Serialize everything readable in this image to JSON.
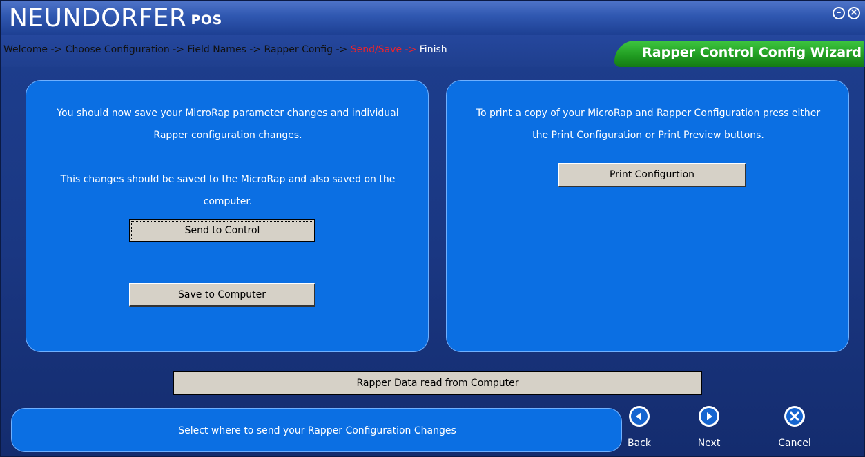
{
  "app": {
    "brand": "NEUNDORFER",
    "brand_suffix": "POS",
    "minimize_glyph": "–",
    "close_glyph": "×"
  },
  "breadcrumb": {
    "steps_before": "Welcome -> Choose Configuration -> Field Names -> Rapper Config -> ",
    "active": "Send/Save",
    "arrow": " -> ",
    "finish": "Finish"
  },
  "wizard_title": "Rapper Control Config Wizard",
  "left_panel": {
    "para1": "You should now save your MicroRap parameter changes and individual Rapper configuration changes.",
    "para2": "This changes should be saved to the MicroRap and also saved on the computer.",
    "send_button": "Send to Control",
    "save_button": "Save to Computer"
  },
  "right_panel": {
    "para1": "To print a copy of your MicroRap and Rapper Configuration press either the Print Configuration or Print Preview buttons.",
    "print_button": "Print Configurtion"
  },
  "status": "Rapper Data read from Computer",
  "hint": "Select where to send your Rapper Configuration Changes",
  "nav": {
    "back": "Back",
    "next": "Next",
    "cancel": "Cancel"
  },
  "colors": {
    "panel": "#0b6fe3",
    "accent_green": "#1f9a20",
    "active_step": "#e8242e",
    "button": "#d6d1c7"
  }
}
